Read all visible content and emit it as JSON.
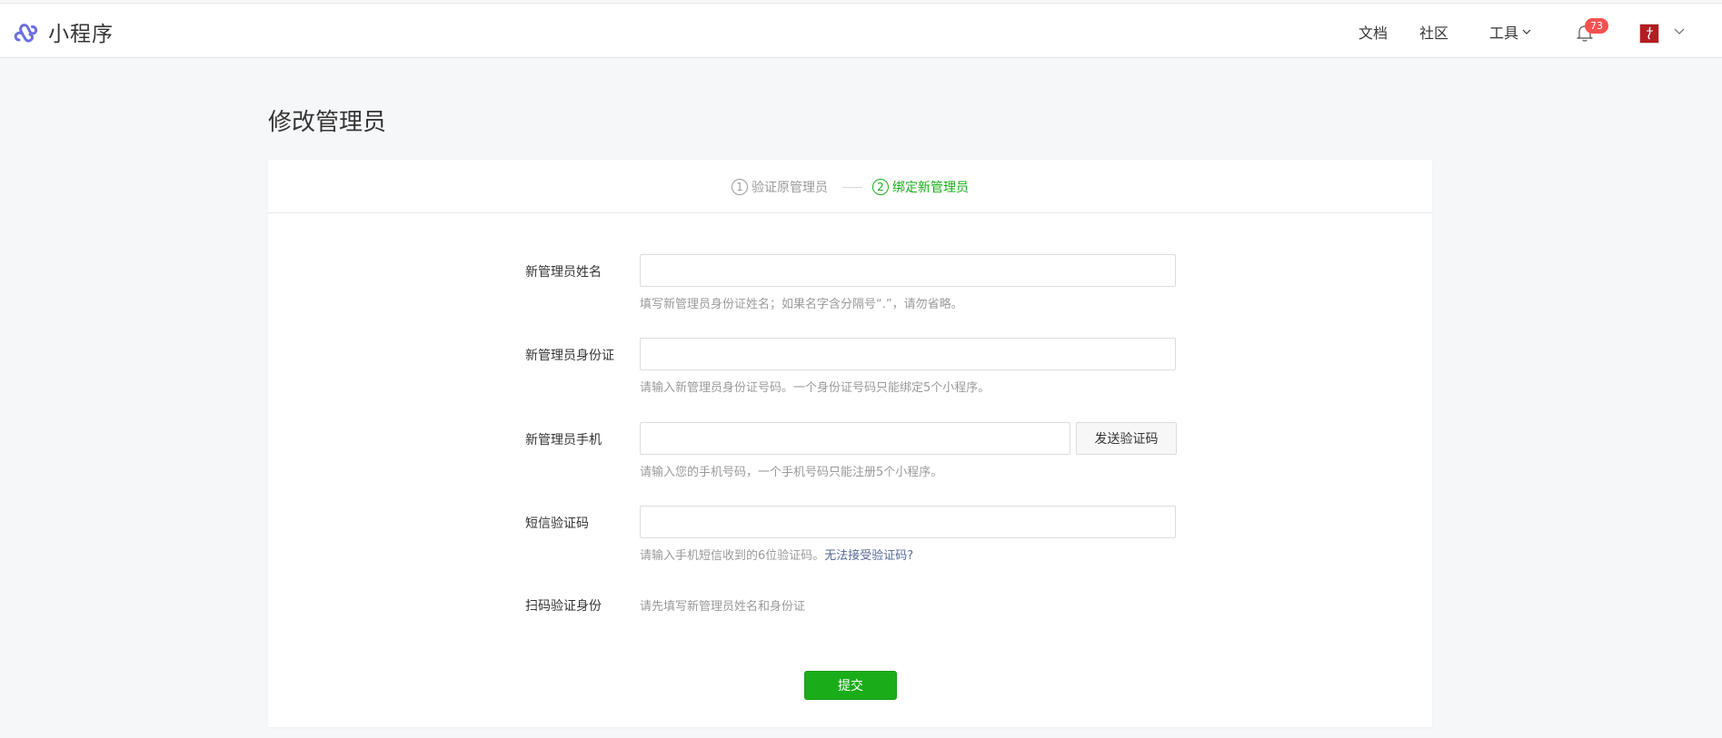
{
  "header": {
    "app_name": "小程序",
    "nav": {
      "docs": "文档",
      "community": "社区",
      "tools": "工具"
    },
    "notification_count": "73",
    "brand_color": "#1aad19"
  },
  "page": {
    "title": "修改管理员"
  },
  "steps": [
    {
      "num": "1",
      "label": "验证原管理员",
      "state": "done"
    },
    {
      "num": "2",
      "label": "绑定新管理员",
      "state": "active"
    }
  ],
  "form": {
    "name": {
      "label": "新管理员姓名",
      "value": "",
      "hint": "填写新管理员身份证姓名；如果名字含分隔号“.”，请勿省略。"
    },
    "id_card": {
      "label": "新管理员身份证",
      "value": "",
      "hint": "请输入新管理员身份证号码。一个身份证号码只能绑定5个小程序。"
    },
    "phone": {
      "label": "新管理员手机",
      "value": "",
      "send_code_label": "发送验证码",
      "hint": "请输入您的手机号码，一个手机号码只能注册5个小程序。"
    },
    "sms_code": {
      "label": "短信验证码",
      "value": "",
      "hint": "请输入手机短信收到的6位验证码。",
      "hint_link": "无法接受验证码?"
    },
    "scan": {
      "label": "扫码验证身份",
      "text": "请先填写新管理员姓名和身份证"
    },
    "submit_label": "提交"
  }
}
